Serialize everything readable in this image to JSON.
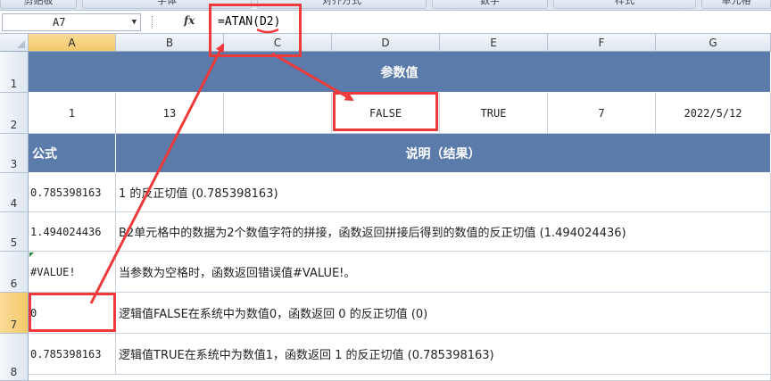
{
  "ribbon": {
    "groups": [
      "剪贴板",
      "字体",
      "对齐方式",
      "数字",
      "样式",
      "单元格"
    ]
  },
  "formula_bar": {
    "name_box": "A7",
    "fx_label": "fx",
    "formula": "=ATAN(D2)"
  },
  "columns": [
    "A",
    "B",
    "C",
    "D",
    "E",
    "F",
    "G"
  ],
  "rows": [
    "1",
    "2",
    "3",
    "4",
    "5",
    "6",
    "7",
    "8"
  ],
  "sheet": {
    "r1_title": "参数值",
    "r2": [
      "1",
      "13",
      "",
      "FALSE",
      "TRUE",
      "7",
      "2022/5/12"
    ],
    "r3_formula_header": "公式",
    "r3_desc_header": "说明（结果）",
    "r4": {
      "value": "0.785398163",
      "desc": "1 的反正切值 (0.785398163)"
    },
    "r5": {
      "value": "1.494024436",
      "desc": "B2单元格中的数据为2个数值字符的拼接，函数返回拼接后得到的数值的反正切值 (1.494024436)"
    },
    "r6": {
      "value": "#VALUE!",
      "desc": "当参数为空格时，函数返回错误值#VALUE!。"
    },
    "r7": {
      "value": "0",
      "desc": "逻辑值FALSE在系统中为数值0，函数返回 0 的反正切值 (0)"
    },
    "r8": {
      "value": "0.785398163",
      "desc": "逻辑值TRUE在系统中为数值1，函数返回 1 的反正切值 (0.785398163)"
    }
  },
  "colors": {
    "header_blue": "#5b7bab",
    "annotation_red": "#ee3a3a",
    "selection_gold": "#f4c86a"
  }
}
